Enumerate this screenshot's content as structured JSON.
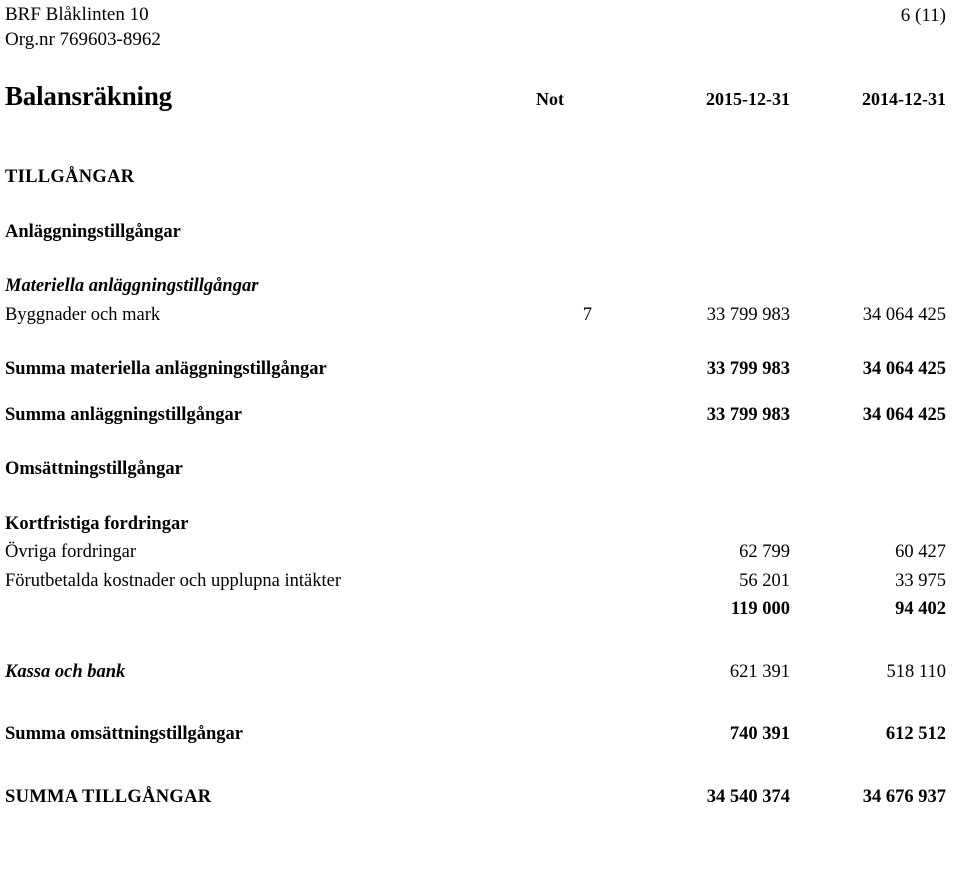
{
  "header": {
    "company": "BRF Blåklinten 10",
    "org_label": "Org.nr 769603-8962",
    "page_number": "6 (11)"
  },
  "statement": {
    "title": "Balansräkning",
    "columns": {
      "note": "Not",
      "current_period": "2015-12-31",
      "previous_period": "2014-12-31"
    }
  },
  "sections": {
    "assets_heading": "TILLGÅNGAR",
    "fixed_assets_heading": "Anläggningstillgångar",
    "tangible_heading": "Materiella anläggningstillgångar",
    "current_assets_heading": "Omsättningstillgångar",
    "receivables_heading": "Kortfristiga fordringar"
  },
  "rows": {
    "buildings_land": {
      "label": "Byggnader och mark",
      "note": "7",
      "current": "33 799 983",
      "previous": "34 064 425"
    },
    "sum_tangible": {
      "label": "Summa materiella anläggningstillgångar",
      "note": "",
      "current": "33 799 983",
      "previous": "34 064 425"
    },
    "sum_fixed": {
      "label": "Summa anläggningstillgångar",
      "note": "",
      "current": "33 799 983",
      "previous": "34 064 425"
    },
    "other_receivables": {
      "label": "Övriga fordringar",
      "note": "",
      "current": "62 799",
      "previous": "60 427"
    },
    "prepaid_expenses": {
      "label": "Förutbetalda kostnader och upplupna intäkter",
      "note": "",
      "current": "56 201",
      "previous": "33 975"
    },
    "sum_receivables": {
      "label": "",
      "note": "",
      "current": "119 000",
      "previous": "94 402"
    },
    "cash_bank": {
      "label": "Kassa och bank",
      "note": "",
      "current": "621 391",
      "previous": "518 110"
    },
    "sum_current_assets": {
      "label": "Summa omsättningstillgångar",
      "note": "",
      "current": "740 391",
      "previous": "612 512"
    },
    "total_assets": {
      "label": "SUMMA TILLGÅNGAR",
      "note": "",
      "current": "34 540 374",
      "previous": "34 676 937"
    }
  }
}
